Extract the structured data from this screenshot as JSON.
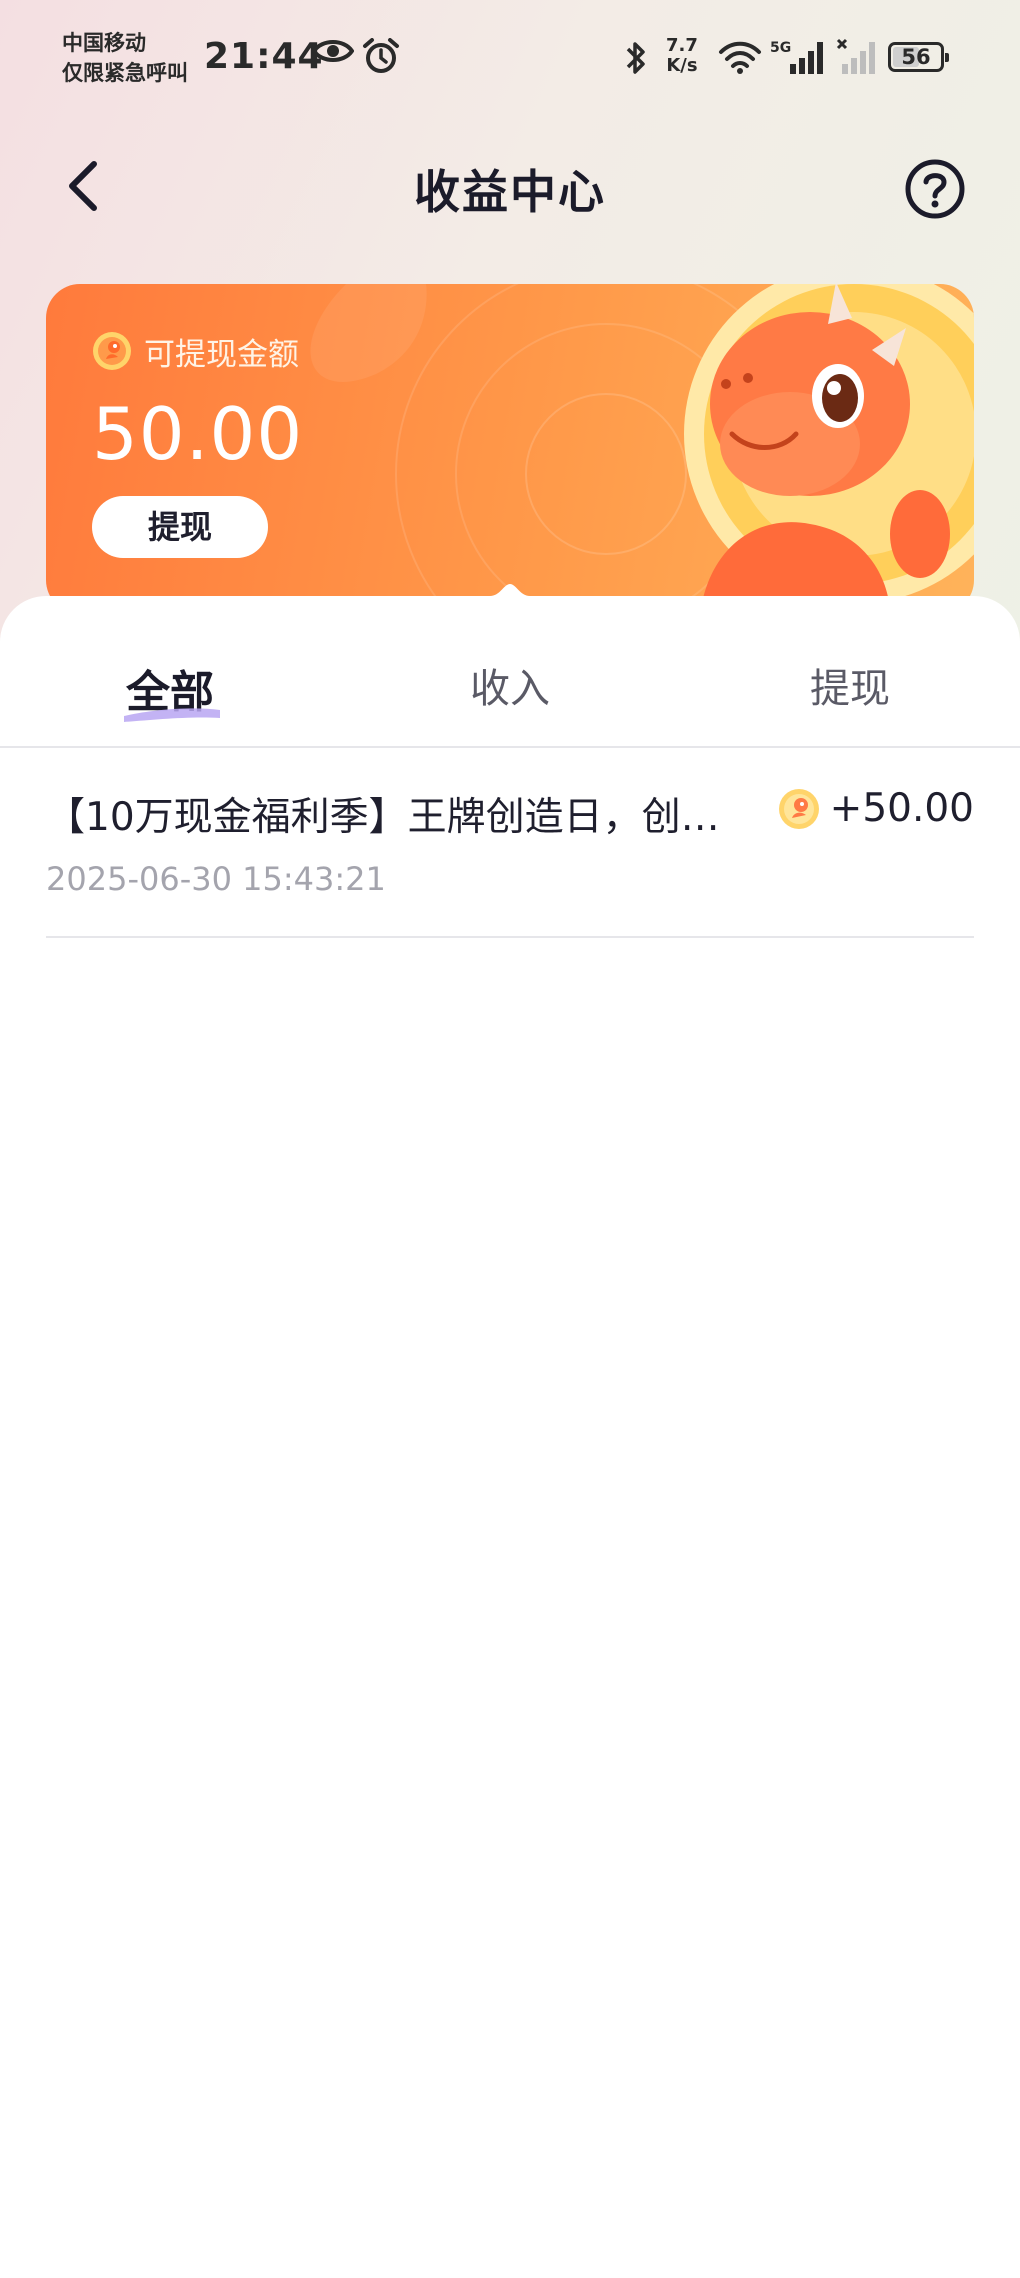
{
  "status_bar": {
    "carrier_line1": "中国移动",
    "carrier_line2": "仅限紧急呼叫",
    "time": "21:44",
    "net_speed_value": "7.7",
    "net_speed_unit": "K/s",
    "network_type": "5G",
    "battery": "56",
    "battery_level": 0.56
  },
  "header": {
    "title": "收益中心"
  },
  "balance_card": {
    "label": "可提现金额",
    "amount": "50.00",
    "withdraw_label": "提现"
  },
  "tabs": [
    {
      "label": "全部",
      "selected": true
    },
    {
      "label": "收入",
      "selected": false
    },
    {
      "label": "提现",
      "selected": false
    }
  ],
  "records": [
    {
      "title": "【10万现金福利季】王牌创造日，创…",
      "time": "2025-06-30 15:43:21",
      "amount": "+50.00"
    }
  ],
  "colors": {
    "card_start": "#ff7a3c",
    "card_end": "#ffb35a",
    "tab_underline": "#b9a6f2",
    "text_primary": "#1f1f2e",
    "text_secondary": "#a4a4ad"
  }
}
